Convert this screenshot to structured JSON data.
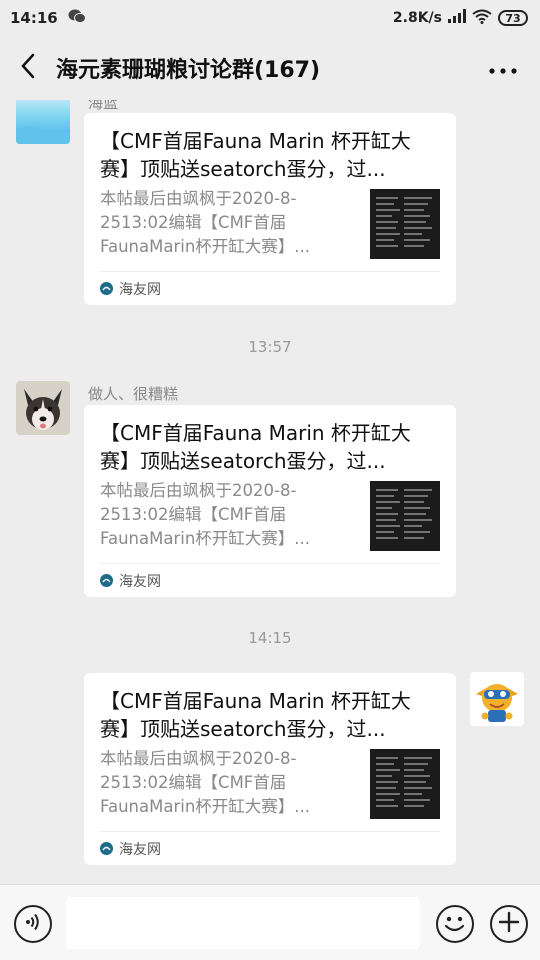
{
  "status_bar": {
    "time": "14:16",
    "network_speed": "2.8K/s",
    "battery": "73"
  },
  "header": {
    "title": "海元素珊瑚粮讨论群(167)"
  },
  "messages": [
    {
      "sender": "海蓝",
      "card": {
        "title": "【CMF首届Fauna Marin 杯开缸大赛】顶贴送seatorch蛋分，过...",
        "description": "本帖最后由飒枫于2020-8-2513:02编辑【CMF首届FaunaMarin杯开缸大赛】...",
        "source": "海友网"
      }
    },
    {
      "timestamp": "13:57",
      "sender": "做人、很糟糕",
      "card": {
        "title": "【CMF首届Fauna Marin 杯开缸大赛】顶贴送seatorch蛋分，过...",
        "description": "本帖最后由飒枫于2020-8-2513:02编辑【CMF首届FaunaMarin杯开缸大赛】...",
        "source": "海友网"
      }
    },
    {
      "timestamp": "14:15",
      "sender": "",
      "card": {
        "title": "【CMF首届Fauna Marin 杯开缸大赛】顶贴送seatorch蛋分，过...",
        "description": "本帖最后由飒枫于2020-8-2513:02编辑【CMF首届FaunaMarin杯开缸大赛】...",
        "source": "海友网"
      }
    }
  ],
  "input": {
    "value": "",
    "placeholder": ""
  },
  "icons": {
    "back": "chevron-left-icon",
    "more": "more-dots-icon",
    "voice": "voice-icon",
    "emoji": "emoji-icon",
    "plus": "plus-icon"
  },
  "colors": {
    "background": "#ededed",
    "card": "#ffffff",
    "muted_text": "#8a8a8a"
  }
}
